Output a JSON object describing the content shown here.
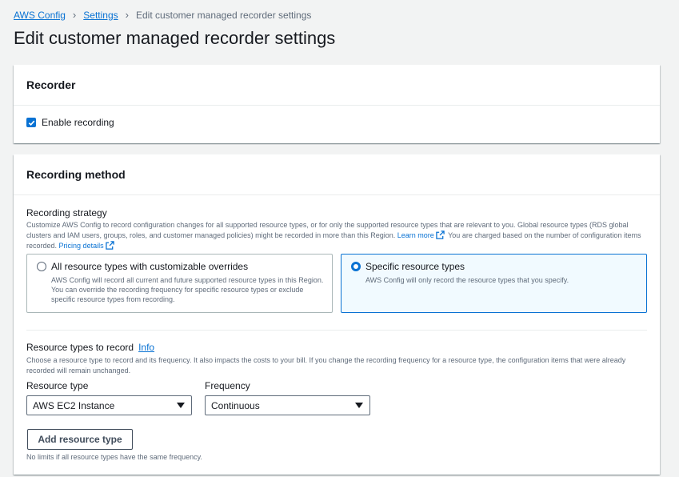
{
  "breadcrumb": {
    "items": [
      {
        "label": "AWS Config"
      },
      {
        "label": "Settings"
      }
    ],
    "current": "Edit customer managed recorder settings"
  },
  "page_title": "Edit customer managed recorder settings",
  "recorder": {
    "title": "Recorder",
    "enable_recording": {
      "label": "Enable recording",
      "checked": true
    }
  },
  "recording_method": {
    "title": "Recording method",
    "strategy": {
      "label": "Recording strategy",
      "description": "Customize AWS Config to record configuration changes for all supported resource types, or for only the supported resource types that are relevant to you. Global resource types (RDS global clusters and IAM users, groups, roles, and customer managed policies) might be recorded in more than this Region.",
      "learn_more": "Learn more",
      "charge_text": "You are charged based on the number of configuration items recorded.",
      "pricing_details": "Pricing details"
    },
    "options": [
      {
        "title": "All resource types with customizable overrides",
        "description": "AWS Config will record all current and future supported resource types in this Region. You can override the recording frequency for specific resource types or exclude specific resource types from recording.",
        "selected": false
      },
      {
        "title": "Specific resource types",
        "description": "AWS Config will only record the resource types that you specify.",
        "selected": true
      }
    ],
    "resource_types": {
      "label": "Resource types to record",
      "info": "Info",
      "description": "Choose a resource type to record and its frequency. It also impacts the costs to your bill. If you change the recording frequency for a resource type, the configuration items that were already recorded will remain unchanged.",
      "resource_type_label": "Resource type",
      "resource_type_value": "AWS EC2 Instance",
      "frequency_label": "Frequency",
      "frequency_value": "Continuous",
      "add_button": "Add resource type",
      "hint": "No limits if all resource types have the same frequency."
    }
  },
  "colors": {
    "link": "#0972d3",
    "background": "#f2f3f3",
    "selected_tile": "#f1faff",
    "text_secondary": "#5f6b7a"
  },
  "icons": [
    "chevron-right-icon",
    "checkmark-icon",
    "external-link-icon",
    "caret-down-icon"
  ]
}
